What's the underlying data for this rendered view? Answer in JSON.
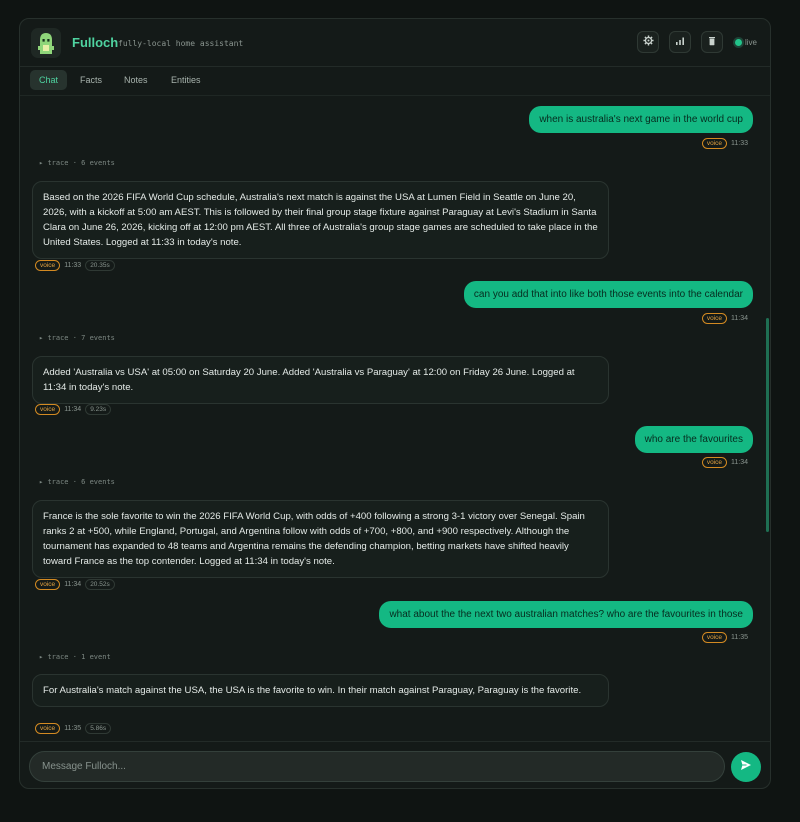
{
  "header": {
    "title": "Fulloch",
    "tagline": "fully-local home assistant",
    "status": "live",
    "icons": [
      "gear-icon",
      "bar-chart-icon",
      "trash-icon",
      "live-dot-icon"
    ]
  },
  "tabs": [
    {
      "label": "Chat",
      "active": true
    },
    {
      "label": "Facts",
      "active": false
    },
    {
      "label": "Notes",
      "active": false
    },
    {
      "label": "Entities",
      "active": false
    }
  ],
  "messages": [
    {
      "role": "user",
      "text": "when is australia's next game in the world cup",
      "badge": "voice",
      "time": "11:33"
    },
    {
      "role": "trace",
      "text": "trace · 6 events"
    },
    {
      "role": "assistant",
      "text": "Based on the 2026 FIFA World Cup schedule, Australia's next match is against the USA at Lumen Field in Seattle on June 20, 2026, with a kickoff at 5:00 am AEST. This is followed by their final group stage fixture against Paraguay at Levi's Stadium in Santa Clara on June 26, 2026, kicking off at 12:00 pm AEST. All three of Australia's group stage games are scheduled to take place in the United States. Logged at 11:33 in today's note.",
      "badge": "voice",
      "time": "11:33",
      "duration": "20.35s"
    },
    {
      "role": "user",
      "text": "can you add that into like both those events into the calendar",
      "badge": "voice",
      "time": "11:34"
    },
    {
      "role": "trace",
      "text": "trace · 7 events"
    },
    {
      "role": "assistant",
      "text": "Added 'Australia vs USA' at 05:00 on Saturday 20 June. Added 'Australia vs Paraguay' at 12:00 on Friday 26 June. Logged at 11:34 in today's note.",
      "badge": "voice",
      "time": "11:34",
      "duration": "9.23s"
    },
    {
      "role": "user",
      "text": "who are the favourites",
      "badge": "voice",
      "time": "11:34"
    },
    {
      "role": "trace",
      "text": "trace · 6 events"
    },
    {
      "role": "assistant",
      "text": "France is the sole favorite to win the 2026 FIFA World Cup, with odds of +400 following a strong 3-1 victory over Senegal. Spain ranks 2 at +500, while England, Portugal, and Argentina follow with odds of +700, +800, and +900 respectively. Although the tournament has expanded to 48 teams and Argentina remains the defending champion, betting markets have shifted heavily toward France as the top contender. Logged at 11:34 in today's note.",
      "badge": "voice",
      "time": "11:34",
      "duration": "20.52s"
    },
    {
      "role": "user",
      "text": "what about the the next two australian matches? who are the favourites in those",
      "badge": "voice",
      "time": "11:35"
    },
    {
      "role": "trace",
      "text": "trace · 1 event"
    },
    {
      "role": "assistant",
      "text": "For Australia's match against the USA, the USA is the favorite to win. In their match against Paraguay, Paraguay is the favorite.",
      "badge": "voice",
      "time": "11:35",
      "duration": "5.86s"
    }
  ],
  "composer": {
    "placeholder": "Message Fulloch...",
    "send_icon": "send-icon"
  },
  "colors": {
    "accent": "#14b883",
    "badge": "#d38a22",
    "background": "#0f1412"
  }
}
